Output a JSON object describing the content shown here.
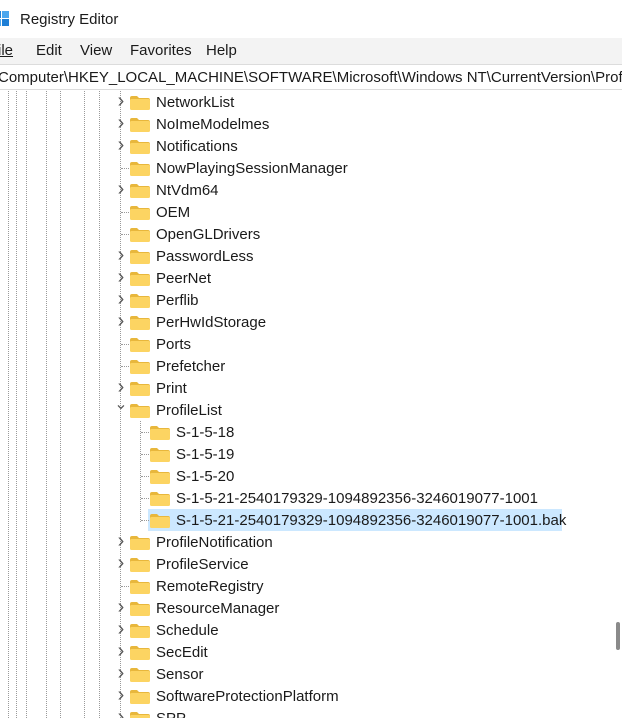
{
  "window": {
    "title": "Registry Editor"
  },
  "menu": {
    "file": "ile",
    "edit": "Edit",
    "view": "View",
    "favorites": "Favorites",
    "help": "Help"
  },
  "address": {
    "path": "Computer\\HKEY_LOCAL_MACHINE\\SOFTWARE\\Microsoft\\Windows NT\\CurrentVersion\\ProfileLi"
  },
  "colors": {
    "selection": "#cce8ff",
    "folder_fill": "#fcd462",
    "folder_tab": "#e8b73c"
  },
  "tree": {
    "items": [
      {
        "label": "NetworkList",
        "expander": "collapsed"
      },
      {
        "label": "NoImeModelmes",
        "expander": "collapsed"
      },
      {
        "label": "Notifications",
        "expander": "collapsed"
      },
      {
        "label": "NowPlayingSessionManager",
        "expander": "none"
      },
      {
        "label": "NtVdm64",
        "expander": "collapsed"
      },
      {
        "label": "OEM",
        "expander": "none"
      },
      {
        "label": "OpenGLDrivers",
        "expander": "none"
      },
      {
        "label": "PasswordLess",
        "expander": "collapsed"
      },
      {
        "label": "PeerNet",
        "expander": "collapsed"
      },
      {
        "label": "Perflib",
        "expander": "collapsed"
      },
      {
        "label": "PerHwIdStorage",
        "expander": "collapsed"
      },
      {
        "label": "Ports",
        "expander": "none"
      },
      {
        "label": "Prefetcher",
        "expander": "none"
      },
      {
        "label": "Print",
        "expander": "collapsed"
      },
      {
        "label": "ProfileList",
        "expander": "expanded"
      },
      {
        "label": "S-1-5-18",
        "expander": "none",
        "child": true
      },
      {
        "label": "S-1-5-19",
        "expander": "none",
        "child": true
      },
      {
        "label": "S-1-5-20",
        "expander": "none",
        "child": true
      },
      {
        "label": "S-1-5-21-2540179329-1094892356-3246019077-1001",
        "expander": "none",
        "child": true
      },
      {
        "label": "S-1-5-21-2540179329-1094892356-3246019077-1001.bak",
        "expander": "none",
        "child": true,
        "selected": true
      },
      {
        "label": "ProfileNotification",
        "expander": "collapsed"
      },
      {
        "label": "ProfileService",
        "expander": "collapsed"
      },
      {
        "label": "RemoteRegistry",
        "expander": "none"
      },
      {
        "label": "ResourceManager",
        "expander": "collapsed"
      },
      {
        "label": "Schedule",
        "expander": "collapsed"
      },
      {
        "label": "SecEdit",
        "expander": "collapsed"
      },
      {
        "label": "Sensor",
        "expander": "collapsed"
      },
      {
        "label": "SoftwareProtectionPlatform",
        "expander": "collapsed"
      },
      {
        "label": "SPP",
        "expander": "collapsed"
      }
    ]
  }
}
